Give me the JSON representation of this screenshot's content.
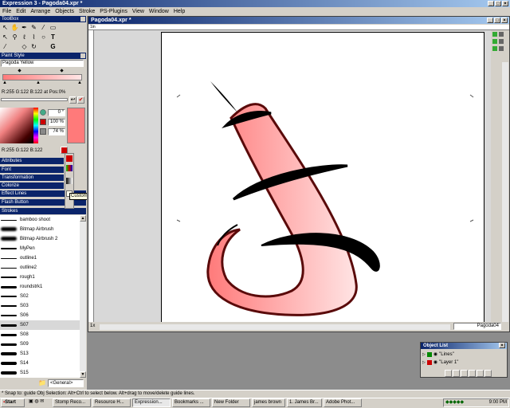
{
  "window": {
    "title": "Expression 3 - Pagoda04.xpr *"
  },
  "menu": [
    "File",
    "Edit",
    "Arrange",
    "Objects",
    "Stroke",
    "PS-Plugins",
    "View",
    "Window",
    "Help"
  ],
  "toolbox": {
    "title": "ToolBox"
  },
  "paint_style": {
    "title": "Paint Style",
    "color_name": "Pagoda Yellow",
    "rgb_pos": "R:255 G:122 B:122 at Pos:0%",
    "rgb": "R:255 G:122 B:122",
    "field1": "0 °",
    "field2": "100 %",
    "field3": "74 %"
  },
  "panels": [
    "Attributes",
    "Font",
    "Transformation",
    "Colorize",
    "Effect Lines",
    "Flash Button",
    "Strokes"
  ],
  "tooltip": "Custom Colors",
  "strokes": [
    {
      "name": "bamboo shoot"
    },
    {
      "name": "Bitmap Airbrush"
    },
    {
      "name": "Bitmap Airbrush 2"
    },
    {
      "name": "MyPen"
    },
    {
      "name": "outline1"
    },
    {
      "name": "outline2"
    },
    {
      "name": "rough1"
    },
    {
      "name": "roundstrk1"
    },
    {
      "name": "S02"
    },
    {
      "name": "S03"
    },
    {
      "name": "S06"
    },
    {
      "name": "S07"
    },
    {
      "name": "S08"
    },
    {
      "name": "S09"
    },
    {
      "name": "S13"
    },
    {
      "name": "S14"
    },
    {
      "name": "S15"
    }
  ],
  "strokes_selected": "S07",
  "strokes_category": "<General>",
  "doc": {
    "title": "Pagoda04.xpr *",
    "ruler_origin": "1in",
    "layer_field": "Pagoda04"
  },
  "object_list": {
    "title": "Object List",
    "items": [
      "\"Lines\"",
      "\"Layer 1\""
    ]
  },
  "status_text": "* Snap to: guide   Obj Selection: Alt+Ctrl to select below. Alt+drag to move/delete guide lines.",
  "taskbar": {
    "start": "Start",
    "items": [
      "Stomp Reco...",
      "Resource H...",
      "Expression...",
      "Bookmarks ...",
      "New Folder",
      "james brown",
      "1. James Br...",
      "Adobe Phot..."
    ],
    "clock": "9:00 PM"
  },
  "colors": {
    "accent": "#0a246a",
    "fill": "#ff7a7a",
    "desktop_gray": "#8c8c8c"
  }
}
